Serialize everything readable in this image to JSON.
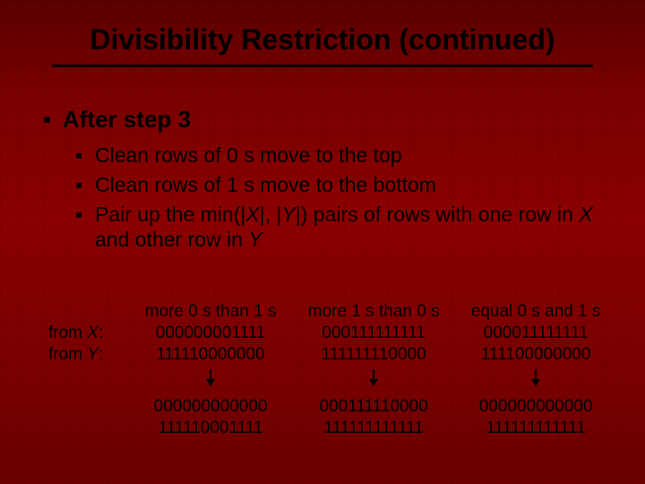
{
  "title": "Divisibility Restriction (continued)",
  "bullets": {
    "lvl1": "After step 3",
    "sub": [
      "Clean rows of 0 s move to the top",
      "Clean rows of 1 s move to the bottom",
      "Pair up the min(|X|, |Y|) pairs of rows with one row in X and other row in Y"
    ]
  },
  "table": {
    "row_labels": [
      "from X:",
      "from Y:"
    ],
    "col_headers": [
      "more 0 s than 1 s",
      "more 1 s than 0 s",
      "equal 0 s and 1 s"
    ],
    "input_rows": [
      [
        "000000001111",
        "000111111111",
        "000011111111"
      ],
      [
        "111110000000",
        "111111110000",
        "111100000000"
      ]
    ],
    "output_rows": [
      [
        "000000000000",
        "000111110000",
        "000000000000"
      ],
      [
        "111110001111",
        "111111111111",
        "111111111111"
      ]
    ]
  }
}
